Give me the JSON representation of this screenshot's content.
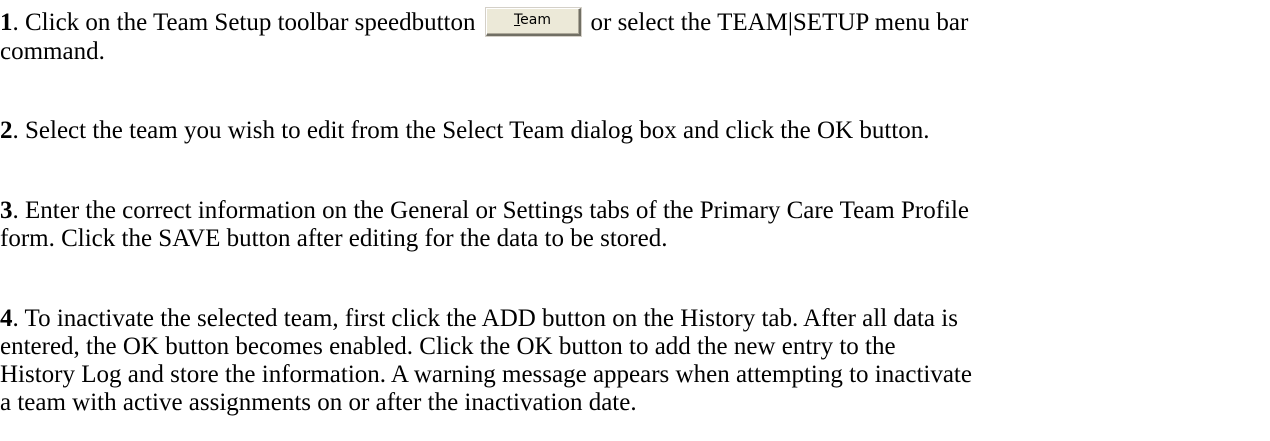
{
  "steps": [
    {
      "number": "1",
      "lines": [
        ". Click on the Team Setup toolbar speedbutton",
        "or select the TEAM|SETUP menu bar",
        "command."
      ],
      "button": {
        "mnemonic": "T",
        "rest": "eam"
      }
    },
    {
      "number": "2",
      "lines": [
        ". Select the team you wish to edit from the Select Team dialog box and click the OK button."
      ]
    },
    {
      "number": "3",
      "lines": [
        ". Enter the correct information on the General or Settings tabs of the Primary Care Team Profile",
        "form. Click the SAVE button after editing for the data to be stored."
      ]
    },
    {
      "number": "4",
      "lines": [
        ". To inactivate the selected team, first click the ADD button on the History tab. After all data is",
        "entered, the OK button becomes enabled. Click the OK button to add the new entry to the",
        "History Log and store the information. A warning message appears when attempting to inactivate",
        "a team with active assignments on or after the inactivation date."
      ]
    }
  ]
}
